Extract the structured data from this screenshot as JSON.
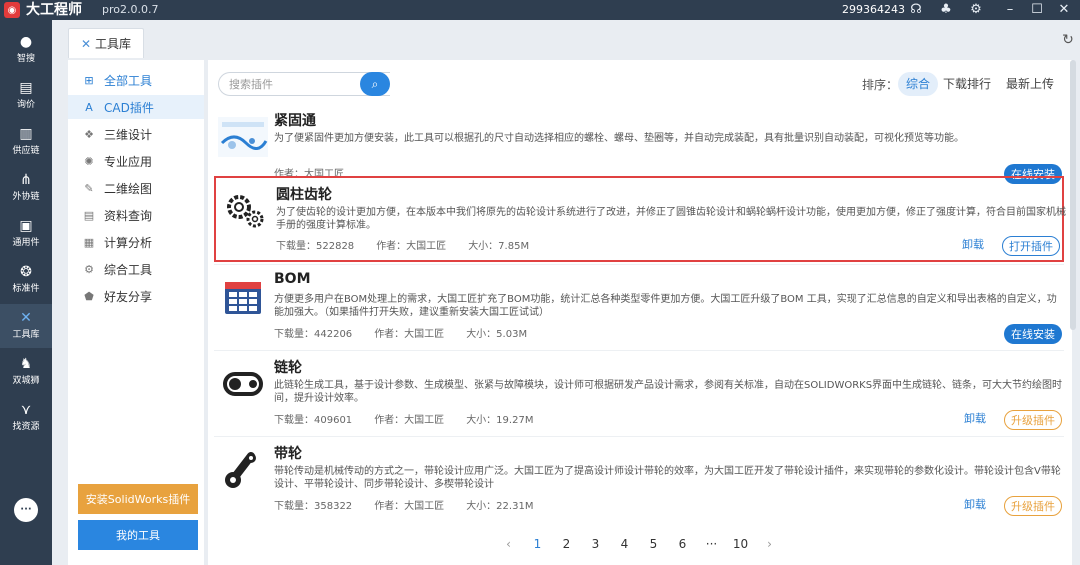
{
  "app": {
    "name": "大工程师",
    "version": "pro2.0.0.7",
    "user_id": "299364243",
    "brand_color": "#2f3e50",
    "accent_color": "#2a86e0"
  },
  "titlebar_icons": [
    "headset-icon",
    "footprint-icon",
    "gear-icon",
    "minimize-icon",
    "maximize-icon",
    "close-icon"
  ],
  "nav": [
    {
      "id": "zhisou",
      "label": "智搜",
      "icon": "search-bulb-icon"
    },
    {
      "id": "xunjia",
      "label": "询价",
      "icon": "quote-icon"
    },
    {
      "id": "gongyinglian",
      "label": "供应链",
      "icon": "buildings-icon"
    },
    {
      "id": "waixielian",
      "label": "外协链",
      "icon": "network-icon"
    },
    {
      "id": "tongyongjian",
      "label": "通用件",
      "icon": "printer-icon"
    },
    {
      "id": "biaozhunjian",
      "label": "标准件",
      "icon": "gears-icon"
    },
    {
      "id": "gongjuku",
      "label": "工具库",
      "icon": "tools-icon"
    },
    {
      "id": "shuangchengji",
      "label": "双城狮",
      "icon": "lion-icon"
    },
    {
      "id": "zhaoziyuan",
      "label": "找资源",
      "icon": "wings-icon"
    }
  ],
  "tab": {
    "label": "工具库"
  },
  "categories": [
    {
      "label": "全部工具",
      "icon": "grid-icon"
    },
    {
      "label": "CAD插件",
      "icon": "font-a-icon"
    },
    {
      "label": "三维设计",
      "icon": "cube-icon"
    },
    {
      "label": "专业应用",
      "icon": "gear-icon"
    },
    {
      "label": "二维绘图",
      "icon": "pencil-ruler-icon"
    },
    {
      "label": "资料查询",
      "icon": "document-icon"
    },
    {
      "label": "计算分析",
      "icon": "calculator-icon"
    },
    {
      "label": "综合工具",
      "icon": "cog-icon"
    },
    {
      "label": "好友分享",
      "icon": "share-icon"
    }
  ],
  "buttons": {
    "install_sw": "安装SolidWorks插件",
    "my_tools": "我的工具"
  },
  "search": {
    "placeholder": "搜索插件"
  },
  "sort": {
    "label": "排序：",
    "options": [
      "综合",
      "下载排行",
      "最新上传"
    ]
  },
  "plugins": [
    {
      "name": "紧固通",
      "desc": "为了便紧固件更加方便安装，此工具可以根据孔的尺寸自动选择相应的螺栓、螺母、垫圈等，并自动完成装配，具有批量识别自动装配，可视化预览等功能。",
      "author": "作者：大国工匠",
      "downloads": "",
      "size": "",
      "action": "在线安装",
      "uninstall": ""
    },
    {
      "name": "圆柱齿轮",
      "desc": "为了使齿轮的设计更加方便，在本版本中我们将原先的齿轮设计系统进行了改进，并修正了圆锥齿轮设计和蜗轮蜗杆设计功能，使用更加方便，修正了强度计算，符合目前国家机械手册的强度计算标准。",
      "downloads": "下载量：522828",
      "author": "作者：大国工匠",
      "size": "大小：7.85M",
      "action": "打开插件",
      "uninstall": "卸载"
    },
    {
      "name": "BOM",
      "desc": "方便更多用户在BOM处理上的需求，大国工匠扩充了BOM功能，统计汇总各种类型零件更加方便。大国工匠升级了BOM 工具，实现了汇总信息的自定义和导出表格的自定义，功能加强大。（如果插件打开失败，建议重新安装大国工匠试试）",
      "downloads": "下载量：442206",
      "author": "作者：大国工匠",
      "size": "大小：5.03M",
      "action": "在线安装",
      "uninstall": ""
    },
    {
      "name": "链轮",
      "desc": "此链轮生成工具，基于设计参数、生成模型、张紧与故障模块，设计师可根据研发产品设计需求，参阅有关标准，自动在SOLIDWORKS界面中生成链轮、链条，可大大节约绘图时间，提升设计效率。",
      "downloads": "下载量：409601",
      "author": "作者：大国工匠",
      "size": "大小：19.27M",
      "action": "升级插件",
      "uninstall": "卸载"
    },
    {
      "name": "带轮",
      "desc": "带轮传动是机械传动的方式之一，带轮设计应用广泛。大国工匠为了提高设计师设计带轮的效率，为大国工匠开发了带轮设计插件，来实现带轮的参数化设计。带轮设计包含V带轮设计、平带轮设计、同步带轮设计、多楔带轮设计",
      "downloads": "下载量：358322",
      "author": "作者：大国工匠",
      "size": "大小：22.31M",
      "action": "升级插件",
      "uninstall": "卸载"
    }
  ],
  "pagination": {
    "pages": [
      "1",
      "2",
      "3",
      "4",
      "5",
      "6",
      "···",
      "10"
    ],
    "current": "1",
    "prev": "‹",
    "next": "›"
  }
}
